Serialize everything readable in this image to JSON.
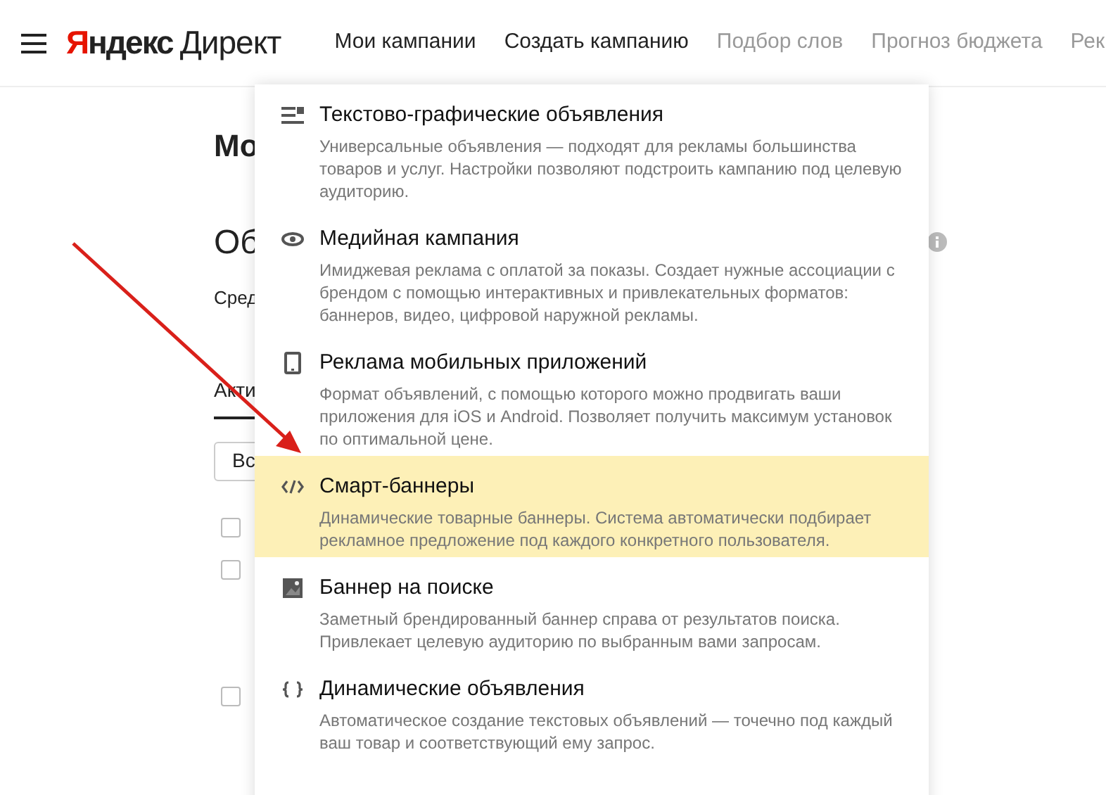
{
  "header": {
    "logo": {
      "brand": "Яндекс",
      "product": "Директ"
    },
    "nav": [
      {
        "label": "Мои кампании",
        "disabled": false
      },
      {
        "label": "Создать кампанию",
        "disabled": false
      },
      {
        "label": "Подбор слов",
        "disabled": true
      },
      {
        "label": "Прогноз бюджета",
        "disabled": true
      },
      {
        "label": "Рек",
        "disabled": true
      }
    ]
  },
  "page": {
    "heading": "Мо",
    "section_title": "Об",
    "subtitle": "Сред",
    "tab": "Акти",
    "filter_button": "Вс",
    "checkboxes": [
      {
        "checked": false
      },
      {
        "checked": false
      },
      {
        "checked": false
      }
    ]
  },
  "campaign_menu": {
    "items": [
      {
        "title": "Текстово-графические объявления",
        "description": "Универсальные объявления — подходят для рекламы большинства товаров и услуг. Настройки позволяют подстроить кампанию под целевую аудиторию.",
        "selected": false
      },
      {
        "title": "Медийная кампания",
        "description": "Имиджевая реклама с оплатой за показы. Создает нужные ассоциации с брендом с помощью интерактивных и привлекательных форматов: баннеров, видео, цифровой наружной рекламы.",
        "selected": false
      },
      {
        "title": "Реклама мобильных приложений",
        "description": "Формат объявлений, с помощью которого можно продвигать ваши приложения для iOS и Android. Позволяет получить максимум установок по оптимальной цене.",
        "selected": false
      },
      {
        "title": "Смарт-баннеры",
        "description": "Динамические товарные баннеры. Система автоматически подбирает рекламное предложение под каждого конкретного пользователя.",
        "selected": true
      },
      {
        "title": "Баннер на поиске",
        "description": "Заметный брендированный баннер справа от результатов поиска. Привлекает целевую аудиторию по выбранным вами запросам.",
        "selected": false
      },
      {
        "title": "Динамические объявления",
        "description": "Автоматическое создание текстовых объявлений — точечно под каждый ваш товар и соответствующий ему запрос.",
        "selected": false
      }
    ]
  }
}
